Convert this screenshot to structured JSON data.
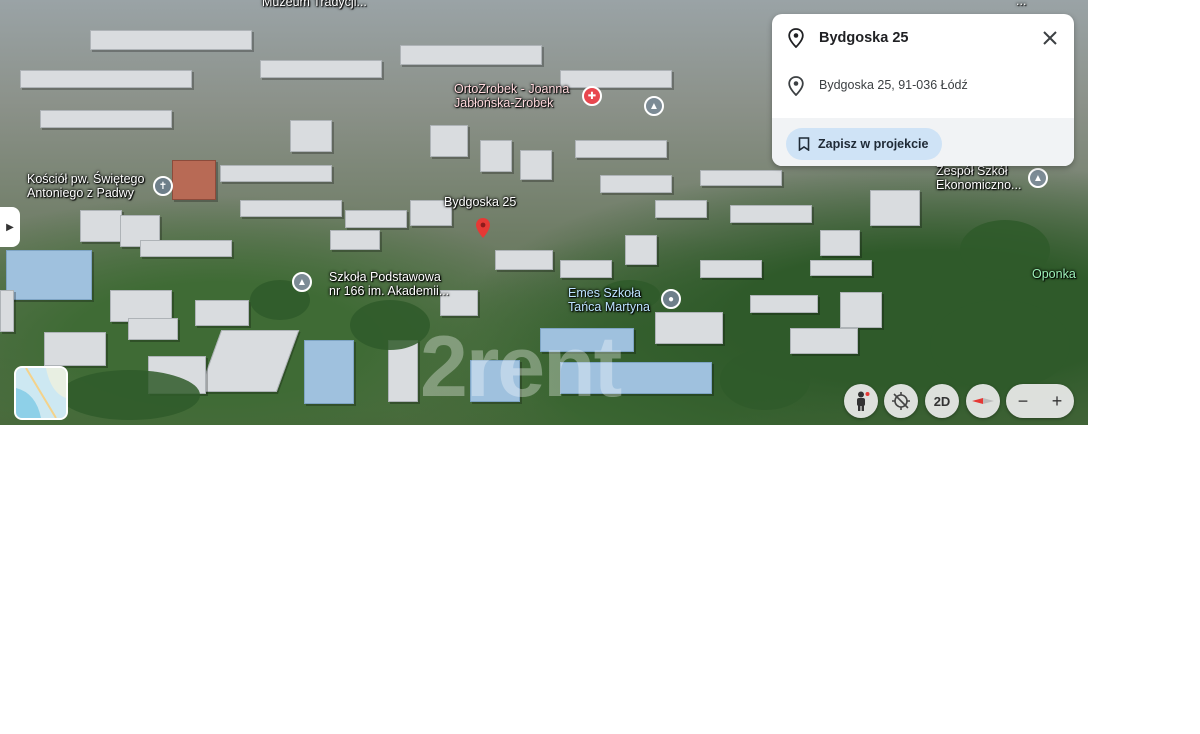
{
  "map": {
    "labels": {
      "top_museum": "Muzeum Tradycji...",
      "top_right": "...",
      "ortodent_line1": "OrtoZrobek - Joanna",
      "ortodent_line2": "Jabłońska-Zrobek",
      "church_line1": "Kościół pw. Świętego",
      "church_line2": "Antoniego z Padwy",
      "selected_place": "Bydgoska 25",
      "school_line1": "Szkoła Podstawowa",
      "school_line2": "nr 166 im. Akademii...",
      "dance_line1": "Emes Szkoła",
      "dance_line2": "Tańca Martyna",
      "econ_line1": "Zespół Szkół",
      "econ_line2": "Ekonomiczno...",
      "oponka": "Oponka"
    },
    "watermark": "2rent",
    "controls": {
      "view_2d": "2D",
      "zoom_out": "−",
      "zoom_in": "+"
    },
    "icons": {
      "pin_color": "#e53935",
      "hospital": "hospital-icon",
      "school": "school-icon",
      "church": "church-icon",
      "place": "place-icon"
    }
  },
  "card": {
    "title": "Bydgoska 25",
    "address": "Bydgoska 25, 91-036 Łódź",
    "save_label": "Zapisz w projekcie",
    "accent": "#cfe3f6"
  }
}
